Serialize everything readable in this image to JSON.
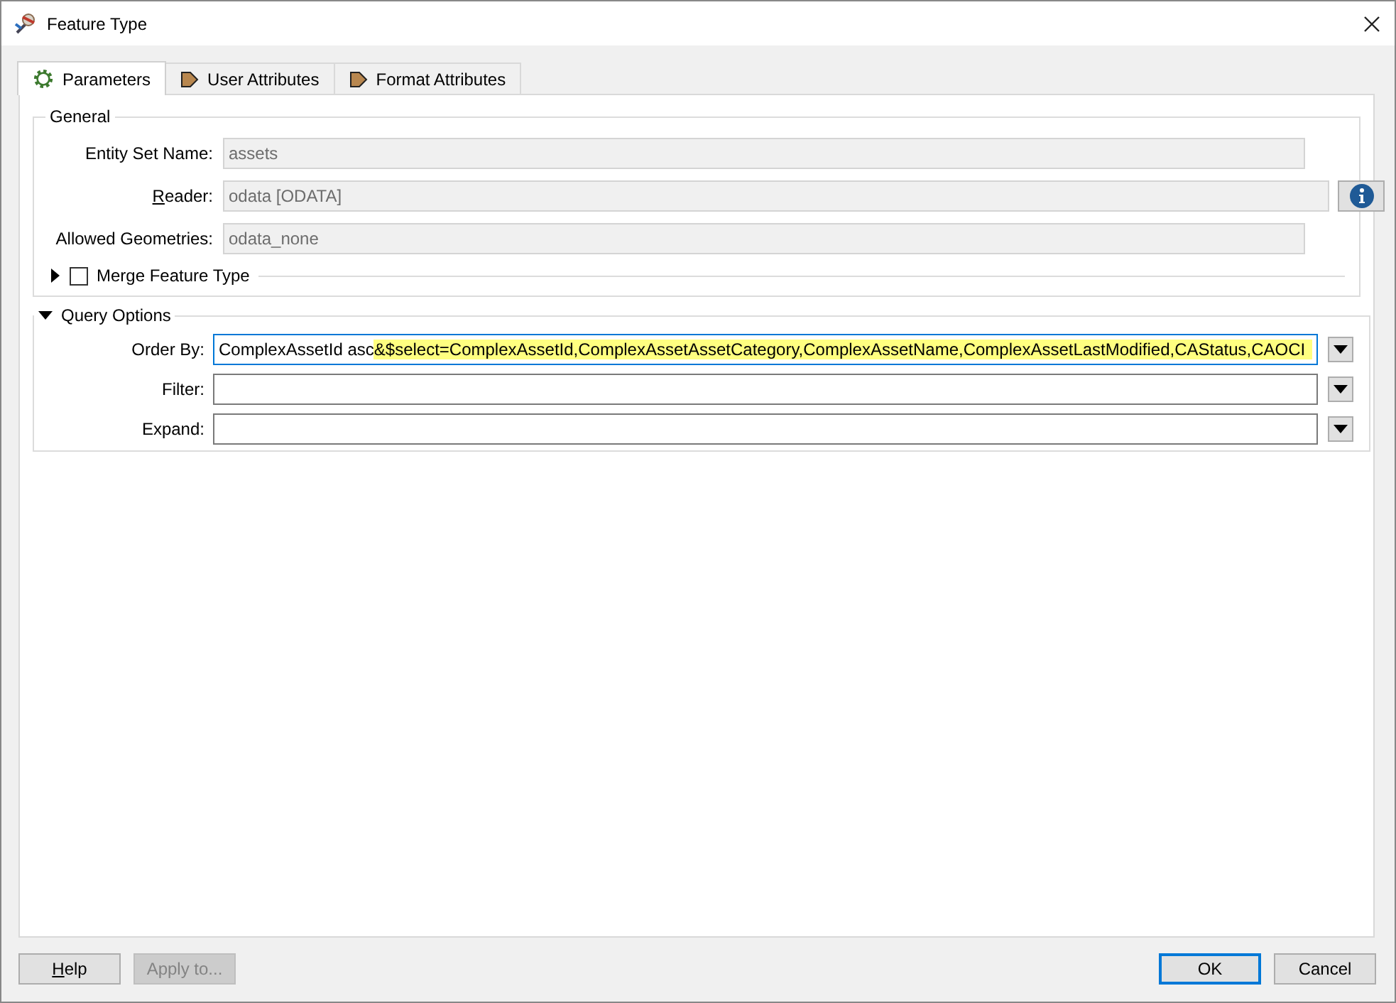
{
  "window": {
    "title": "Feature Type"
  },
  "tabs": [
    {
      "label": "Parameters",
      "kind": "gear",
      "selected": true
    },
    {
      "label": "User Attributes",
      "kind": "arrow",
      "selected": false
    },
    {
      "label": "Format Attributes",
      "kind": "arrow",
      "selected": false
    }
  ],
  "general": {
    "title": "General",
    "fields": [
      {
        "label": "Entity Set Name:",
        "value": "assets",
        "access_key_underlined": false,
        "info_button": false
      },
      {
        "label": "Reader:",
        "value": "odata [ODATA]",
        "access_key_underlined": true,
        "info_button": true
      },
      {
        "label": "Allowed Geometries:",
        "value": "odata_none",
        "access_key_underlined": false,
        "info_button": false
      }
    ],
    "merge": {
      "label": "Merge Feature Type",
      "expanded": false,
      "checked": false
    }
  },
  "query_options": {
    "title": "Query Options",
    "expanded": true,
    "fields": [
      {
        "label": "Order By:",
        "focused": true,
        "parts": [
          {
            "text": "ComplexAssetId asc",
            "highlighted": false
          },
          {
            "text": "&$select=ComplexAssetId,ComplexAssetAssetCategory,ComplexAssetName,ComplexAssetLastModified,CAStatus,CAOCI",
            "highlighted": true
          }
        ]
      },
      {
        "label": "Filter:",
        "focused": false
      },
      {
        "label": "Expand:",
        "focused": false
      }
    ]
  },
  "buttons": [
    {
      "label": "Help",
      "disabled": false,
      "default": false,
      "access_key_underlined": true
    },
    {
      "label": "Apply to...",
      "disabled": true,
      "default": false,
      "access_key_underlined": false
    },
    {
      "label": "OK",
      "disabled": false,
      "default": true,
      "access_key_underlined": false
    },
    {
      "label": "Cancel",
      "disabled": false,
      "default": false,
      "access_key_underlined": false
    }
  ]
}
